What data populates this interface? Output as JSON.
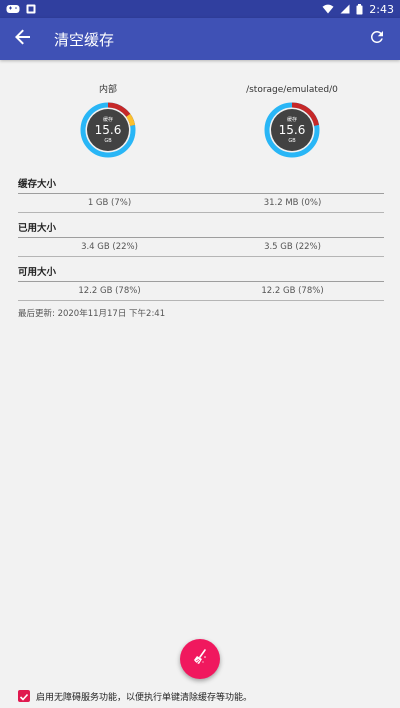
{
  "statusbar": {
    "time": "2:43",
    "colors": {
      "bg": "#303f9f"
    }
  },
  "appbar": {
    "title": "清空缓存",
    "bg": "#3f51b5",
    "icons": {
      "back": "arrow-back-icon",
      "refresh": "refresh-icon"
    }
  },
  "volumes": [
    {
      "label": "内部",
      "center_value": "15.6",
      "center_unit": "GB",
      "inner_label": "缓存",
      "used_fraction": 0.22,
      "cache_fraction": 0.07
    },
    {
      "label": "/storage/emulated/0",
      "center_value": "15.6",
      "center_unit": "GB",
      "inner_label": "缓存",
      "used_fraction": 0.22,
      "cache_fraction": 0.0
    }
  ],
  "sections": [
    {
      "title": "缓存大小",
      "values": [
        "1 GB (7%)",
        "31.2 MB (0%)"
      ]
    },
    {
      "title": "已用大小",
      "values": [
        "3.4 GB (22%)",
        "3.5 GB (22%)"
      ]
    },
    {
      "title": "可用大小",
      "values": [
        "12.2 GB (78%)",
        "12.2 GB (78%)"
      ]
    }
  ],
  "last_updated": "最后更新: 2020年11月17日 下午2:41",
  "fab": {
    "icon": "broom-icon",
    "color": "#f0185e"
  },
  "accessibility": {
    "checked": true,
    "label": "启用无障碍服务功能，以便执行单键清除缓存等功能。"
  },
  "colors": {
    "ring_free": "#29b6f6",
    "ring_used": "#c62828",
    "ring_cache": "#fbc02d",
    "center": "#424242"
  }
}
